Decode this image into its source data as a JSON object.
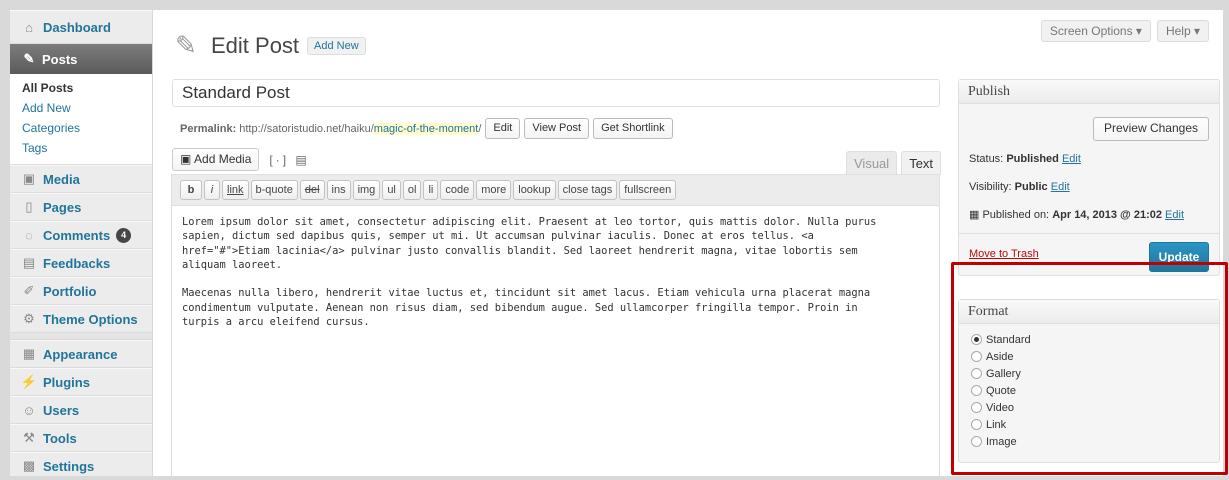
{
  "sidebar": {
    "dashboard": "Dashboard",
    "posts": "Posts",
    "posts_sub": [
      "All Posts",
      "Add New",
      "Categories",
      "Tags"
    ],
    "media": "Media",
    "pages": "Pages",
    "comments": "Comments",
    "comments_count": "4",
    "feedbacks": "Feedbacks",
    "portfolio": "Portfolio",
    "theme_options": "Theme Options",
    "appearance": "Appearance",
    "plugins": "Plugins",
    "users": "Users",
    "tools": "Tools",
    "settings": "Settings"
  },
  "screen_tabs": {
    "screen_options": "Screen Options ▾",
    "help": "Help ▾"
  },
  "header": {
    "title": "Edit Post",
    "add_new": "Add New"
  },
  "post": {
    "title": "Standard Post",
    "permalink_label": "Permalink:",
    "permalink_base": "http://satoristudio.net/haiku/",
    "permalink_slug": "magic-of-the-moment",
    "permalink_end": "/",
    "edit_btn": "Edit",
    "view_btn": "View Post",
    "shortlink_btn": "Get Shortlink"
  },
  "editor": {
    "add_media": "Add Media",
    "tab_visual": "Visual",
    "tab_text": "Text",
    "quicktags": [
      "b",
      "i",
      "link",
      "b-quote",
      "del",
      "ins",
      "img",
      "ul",
      "ol",
      "li",
      "code",
      "more",
      "lookup",
      "close tags",
      "fullscreen"
    ],
    "content": "Lorem ipsum dolor sit amet, consectetur adipiscing elit. Praesent at leo tortor, quis mattis dolor. Nulla purus\nsapien, dictum sed dapibus quis, semper ut mi. Ut accumsan pulvinar iaculis. Donec at eros tellus. <a\nhref=\"#\">Etiam lacinia</a> pulvinar justo convallis blandit. Sed laoreet hendrerit magna, vitae lobortis sem\naliquam laoreet.\n\nMaecenas nulla libero, hendrerit vitae luctus et, tincidunt sit amet lacus. Etiam vehicula urna placerat magna\ncondimentum vulputate. Aenean non risus diam, sed bibendum augue. Sed ullamcorper fringilla tempor. Proin in\nturpis a arcu eleifend cursus."
  },
  "publish": {
    "title": "Publish",
    "preview": "Preview Changes",
    "status_label": "Status:",
    "status_value": "Published",
    "visibility_label": "Visibility:",
    "visibility_value": "Public",
    "published_label": "Published on:",
    "published_value": "Apr 14, 2013 @ 21:02",
    "edit": "Edit",
    "trash": "Move to Trash",
    "update": "Update"
  },
  "format": {
    "title": "Format",
    "options": [
      "Standard",
      "Aside",
      "Gallery",
      "Quote",
      "Video",
      "Link",
      "Image"
    ],
    "selected": "Standard"
  },
  "colors": {
    "link": "#21759b",
    "highlight": "#c00000",
    "update_btn": "#21759b"
  }
}
